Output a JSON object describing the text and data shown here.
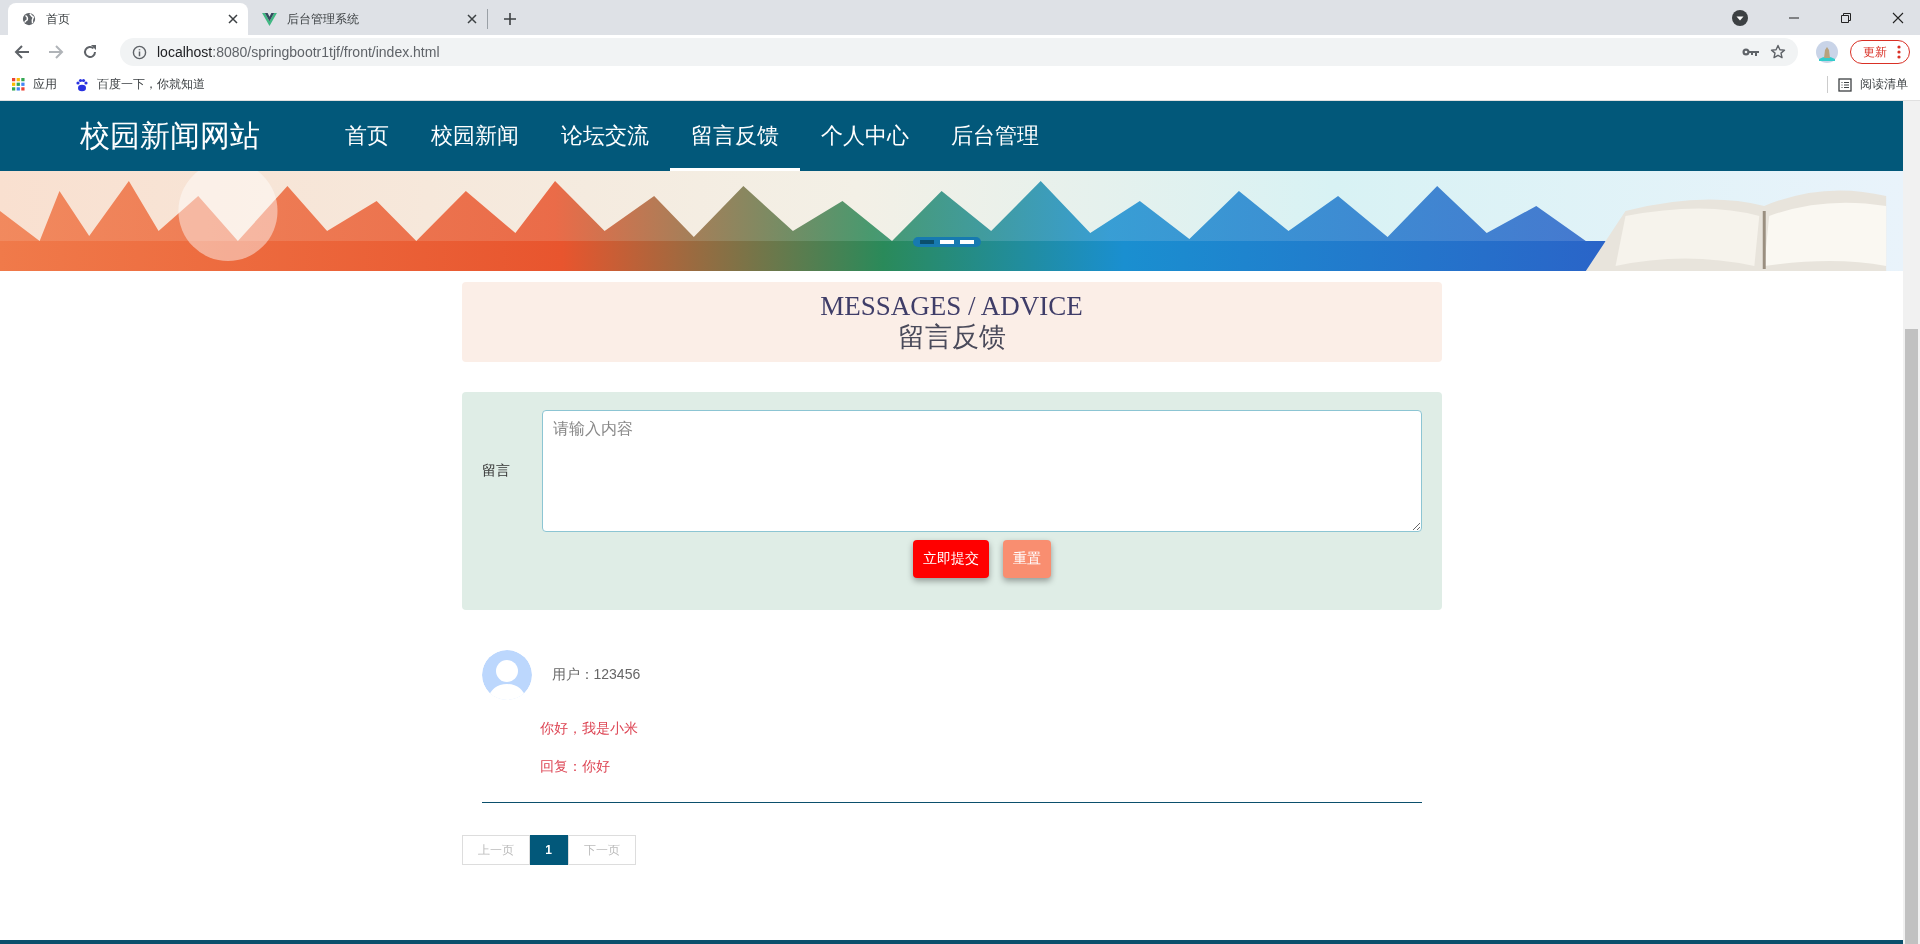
{
  "browser": {
    "tabs": [
      {
        "title": "首页",
        "selected": true,
        "kind": "globe"
      },
      {
        "title": "后台管理系统",
        "selected": false,
        "kind": "vue"
      }
    ],
    "url_host": "localhost",
    "url_rest": ":8080/springbootr1tjf/front/index.html",
    "update_button": "更新",
    "bookmarks": [
      {
        "label": "应用",
        "kind": "apps"
      },
      {
        "label": "百度一下，你就知道",
        "kind": "paw"
      }
    ],
    "reading_list": "阅读清单"
  },
  "site": {
    "logo": "校园新闻网站",
    "nav": [
      {
        "label": "首页",
        "selected": false
      },
      {
        "label": "校园新闻",
        "selected": false
      },
      {
        "label": "论坛交流",
        "selected": false
      },
      {
        "label": "留言反馈",
        "selected": true
      },
      {
        "label": "个人中心",
        "selected": false
      },
      {
        "label": "后台管理",
        "selected": false
      }
    ]
  },
  "banner": {
    "kind": "picture",
    "slides": [
      {
        "selected": true
      },
      {
        "selected": false
      },
      {
        "selected": false
      }
    ]
  },
  "heading": {
    "english": "MESSAGES / ADVICE",
    "chinese": "留言反馈"
  },
  "form": {
    "label": "留言",
    "placeholder": "请输入内容",
    "submit": "立即提交",
    "reset": "重置"
  },
  "messages": [
    {
      "user": "用户：123456",
      "content": "你好，我是小米",
      "reply": "回复：你好"
    }
  ],
  "pagination": {
    "prev": "上一页",
    "pages": [
      {
        "label": "1",
        "selected": true
      }
    ],
    "next": "下一页"
  }
}
